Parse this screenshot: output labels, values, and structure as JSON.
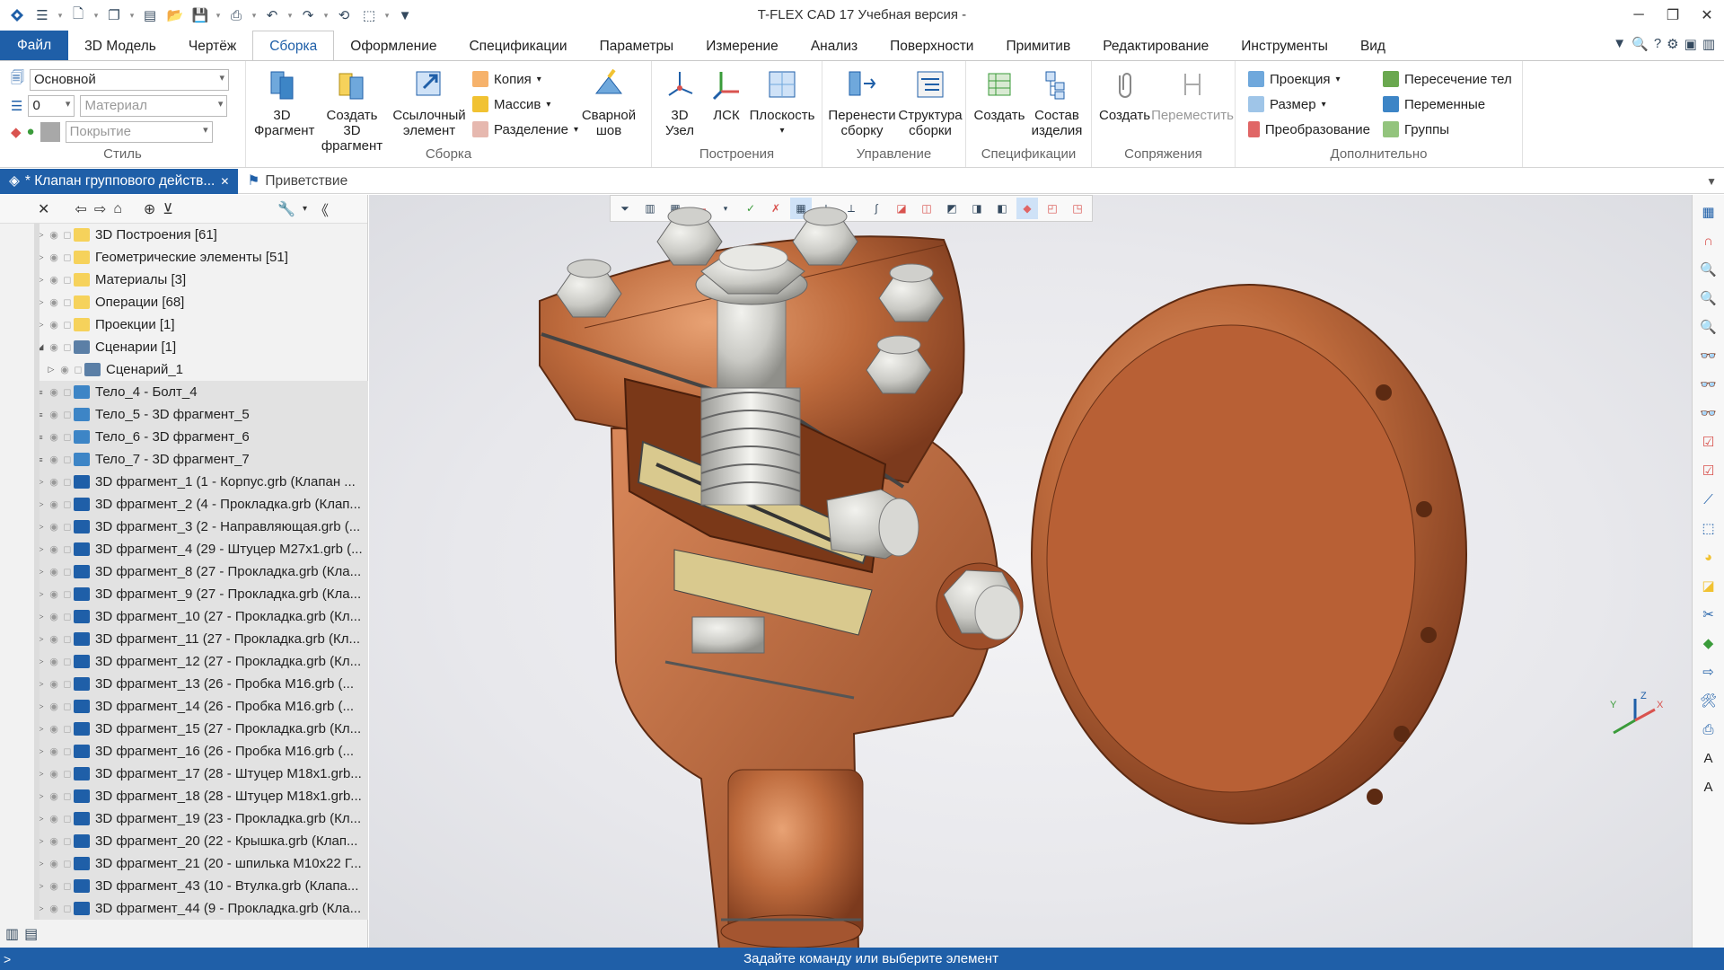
{
  "window": {
    "title": "T-FLEX CAD 17 Учебная версия -"
  },
  "ribbon_tabs": [
    "Файл",
    "3D Модель",
    "Чертёж",
    "Сборка",
    "Оформление",
    "Спецификации",
    "Параметры",
    "Измерение",
    "Анализ",
    "Поверхности",
    "Примитив",
    "Редактирование",
    "Инструменты",
    "Вид"
  ],
  "active_tab": "Сборка",
  "style_group": {
    "label": "Стиль",
    "layer": "Основной",
    "level": "0",
    "material_placeholder": "Материал",
    "coating_placeholder": "Покрытие"
  },
  "assembly_group": {
    "label": "Сборка",
    "fragment": "3D Фрагмент",
    "create_fragment": "Создать 3D фрагмент",
    "ref_element": "Ссылочный элемент",
    "copy": "Копия",
    "array": "Массив",
    "split": "Разделение",
    "weld": "Сварной шов"
  },
  "build_group": {
    "label": "Построения",
    "node": "3D Узел",
    "lcs": "ЛСК",
    "plane": "Плоскость"
  },
  "manage_group": {
    "label": "Управление",
    "move_assembly": "Перенести сборку",
    "structure": "Структура сборки"
  },
  "spec_group": {
    "label": "Спецификации",
    "create": "Создать",
    "composition": "Состав изделия"
  },
  "mates_group": {
    "label": "Сопряжения",
    "create": "Создать",
    "move": "Переместить"
  },
  "extra_group": {
    "label": "Дополнительно",
    "projection": "Проекция",
    "size": "Размер",
    "transform": "Преобразование",
    "intersection": "Пересечение тел",
    "variables": "Переменные",
    "groups": "Группы"
  },
  "doc_tabs": {
    "active": "* Клапан группового действ...",
    "welcome": "Приветствие"
  },
  "tree": [
    {
      "label": "3D Построения [61]",
      "type": "folder",
      "indent": 0,
      "exp": "▷"
    },
    {
      "label": "Геометрические элементы [51]",
      "type": "folder",
      "indent": 0,
      "exp": "▷"
    },
    {
      "label": "Материалы [3]",
      "type": "folder",
      "indent": 0,
      "exp": "▷"
    },
    {
      "label": "Операции [68]",
      "type": "folder",
      "indent": 0,
      "exp": "▷"
    },
    {
      "label": "Проекции [1]",
      "type": "folder",
      "indent": 0,
      "exp": "▷"
    },
    {
      "label": "Сценарии [1]",
      "type": "scenario",
      "indent": 0,
      "exp": "◢"
    },
    {
      "label": "Сценарий_1",
      "type": "scenario",
      "indent": 1,
      "exp": "▷"
    },
    {
      "label": "Тело_4 - Болт_4",
      "type": "body",
      "indent": 0,
      "exp": "≡"
    },
    {
      "label": "Тело_5 - 3D фрагмент_5",
      "type": "body",
      "indent": 0,
      "exp": "≡"
    },
    {
      "label": "Тело_6 - 3D фрагмент_6",
      "type": "body",
      "indent": 0,
      "exp": "≡"
    },
    {
      "label": "Тело_7 - 3D фрагмент_7",
      "type": "body",
      "indent": 0,
      "exp": "≡"
    },
    {
      "label": "3D фрагмент_1 (1 - Корпус.grb (Клапан ...",
      "type": "frag",
      "indent": 0,
      "exp": "▷"
    },
    {
      "label": "3D фрагмент_2 (4 - Прокладка.grb (Клап...",
      "type": "frag",
      "indent": 0,
      "exp": "▷"
    },
    {
      "label": "3D фрагмент_3 (2 - Направляющая.grb (...",
      "type": "frag",
      "indent": 0,
      "exp": "▷"
    },
    {
      "label": "3D фрагмент_4 (29 - Штуцер М27х1.grb (...",
      "type": "frag",
      "indent": 0,
      "exp": "▷"
    },
    {
      "label": "3D фрагмент_8 (27 - Прокладка.grb (Кла...",
      "type": "frag",
      "indent": 0,
      "exp": "▷"
    },
    {
      "label": "3D фрагмент_9 (27 - Прокладка.grb (Кла...",
      "type": "frag",
      "indent": 0,
      "exp": "▷"
    },
    {
      "label": "3D фрагмент_10 (27 - Прокладка.grb (Кл...",
      "type": "frag",
      "indent": 0,
      "exp": "▷"
    },
    {
      "label": "3D фрагмент_11 (27 - Прокладка.grb (Кл...",
      "type": "frag",
      "indent": 0,
      "exp": "▷"
    },
    {
      "label": "3D фрагмент_12 (27 - Прокладка.grb (Кл...",
      "type": "frag",
      "indent": 0,
      "exp": "▷"
    },
    {
      "label": "3D фрагмент_13 (26 - Пробка М16.grb (...",
      "type": "frag",
      "indent": 0,
      "exp": "▷"
    },
    {
      "label": "3D фрагмент_14 (26 - Пробка М16.grb (...",
      "type": "frag",
      "indent": 0,
      "exp": "▷"
    },
    {
      "label": "3D фрагмент_15 (27 - Прокладка.grb (Кл...",
      "type": "frag",
      "indent": 0,
      "exp": "▷"
    },
    {
      "label": "3D фрагмент_16 (26 - Пробка М16.grb (...",
      "type": "frag",
      "indent": 0,
      "exp": "▷"
    },
    {
      "label": "3D фрагмент_17 (28 - Штуцер М18х1.grb...",
      "type": "frag",
      "indent": 0,
      "exp": "▷"
    },
    {
      "label": "3D фрагмент_18 (28 - Штуцер М18х1.grb...",
      "type": "frag",
      "indent": 0,
      "exp": "▷"
    },
    {
      "label": "3D фрагмент_19 (23 - Прокладка.grb (Кл...",
      "type": "frag",
      "indent": 0,
      "exp": "▷"
    },
    {
      "label": "3D фрагмент_20 (22 - Крышка.grb (Клап...",
      "type": "frag",
      "indent": 0,
      "exp": "▷"
    },
    {
      "label": "3D фрагмент_21 (20 - шпилька М10х22 Г...",
      "type": "frag",
      "indent": 0,
      "exp": "▷"
    },
    {
      "label": "3D фрагмент_43 (10 - Втулка.grb (Клапа...",
      "type": "frag",
      "indent": 0,
      "exp": "▷"
    },
    {
      "label": "3D фрагмент_44 (9 - Прокладка.grb (Кла...",
      "type": "frag",
      "indent": 0,
      "exp": "▷"
    }
  ],
  "triad": {
    "x": "X",
    "y": "Y",
    "z": "Z"
  },
  "status": {
    "prompt": ">",
    "text": "Задайте команду или выберите элемент"
  },
  "colors": {
    "accent": "#1f5fa8",
    "bronze": "#b8663a",
    "steel": "#cfcfcc"
  }
}
